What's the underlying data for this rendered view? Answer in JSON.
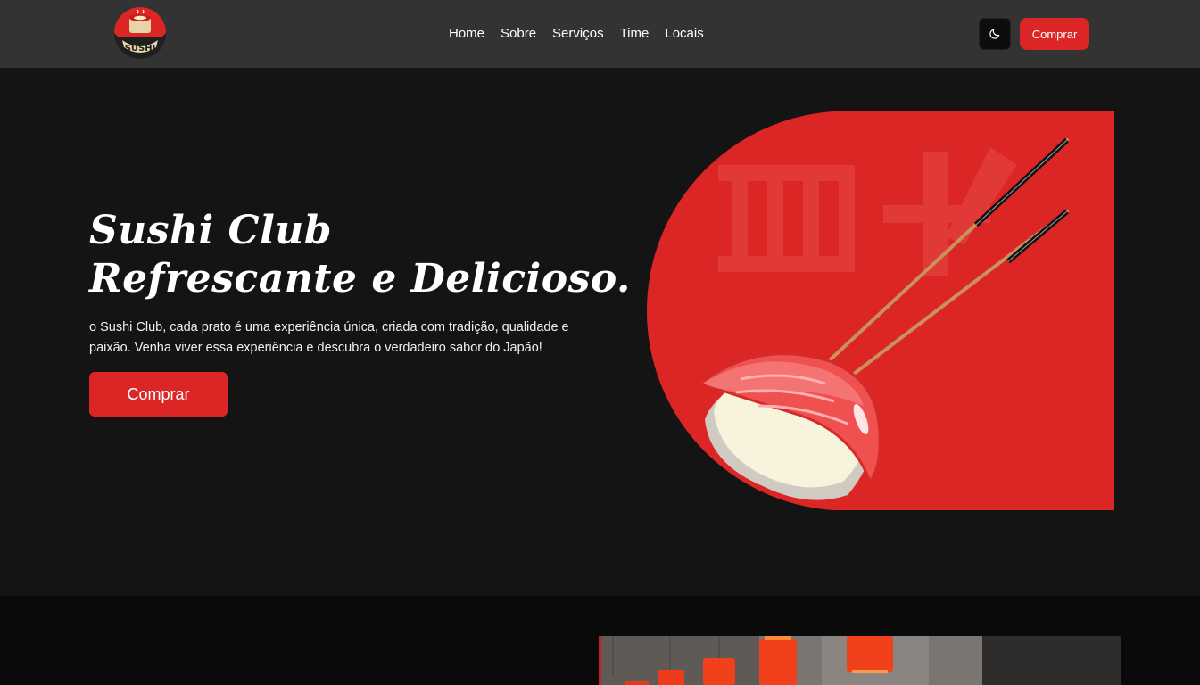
{
  "brand": {
    "logo_text": "SUSHI",
    "accent_color": "#dc2626"
  },
  "nav": {
    "links": [
      "Home",
      "Sobre",
      "Serviços",
      "Time",
      "Locais"
    ],
    "theme_icon": "moon-icon",
    "cta_label": "Comprar"
  },
  "hero": {
    "title_line1": "Sushi Club",
    "title_line2": "Refrescante e Delicioso.",
    "description": "o Sushi Club, cada prato é uma experiência única, criada com tradição, qualidade e paixão. Venha viver essa experiência e descubra o verdadeiro sabor do Japão!",
    "cta_label": "Comprar"
  }
}
